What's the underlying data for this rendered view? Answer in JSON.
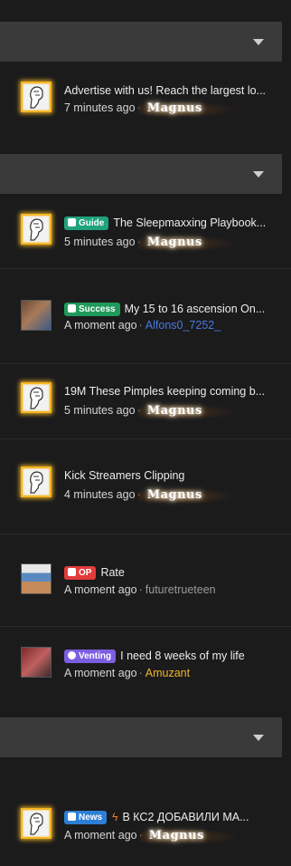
{
  "sections": [
    {
      "name": "section-1"
    },
    {
      "name": "section-2"
    },
    {
      "name": "section-3"
    }
  ],
  "threads": [
    {
      "title": "Advertise with us! Reach the largest lo...",
      "time": "7 minutes ago",
      "user": "Magnus",
      "avatar": "moai-avatar"
    },
    {
      "badge": "Guide",
      "title": "The Sleepmaxxing Playbook...",
      "time": "5 minutes ago",
      "user": "Magnus",
      "avatar": "moai-avatar"
    },
    {
      "badge": "Success",
      "title": "My 15 to 16 ascension On...",
      "time": "A moment ago",
      "user": "Alfons0_7252_",
      "avatar": "photo-avatar"
    },
    {
      "title": "19M These Pimples keeping coming b...",
      "time": "5 minutes ago",
      "user": "Magnus",
      "avatar": "moai-avatar"
    },
    {
      "title": "Kick Streamers Clipping",
      "time": "4 minutes ago",
      "user": "Magnus",
      "avatar": "moai-avatar"
    },
    {
      "badge": "OP",
      "title": "Rate",
      "time": "A moment ago",
      "user": "futuretrueteen",
      "avatar": "meme-avatar"
    },
    {
      "badge": "Venting",
      "title": "I need 8 weeks of my life",
      "time": "A moment ago",
      "user": "Amuzant",
      "avatar": "photo-avatar"
    },
    {
      "badge": "News",
      "title": "В КС2 ДОБАВИЛИ МА...",
      "time": "A moment ago",
      "user": "Magnus",
      "avatar": "moai-avatar"
    }
  ],
  "meta_separator": "·",
  "colors": {
    "gold": "#f6b623",
    "header": "#3a3a3a",
    "background": "#1b1b1c"
  }
}
